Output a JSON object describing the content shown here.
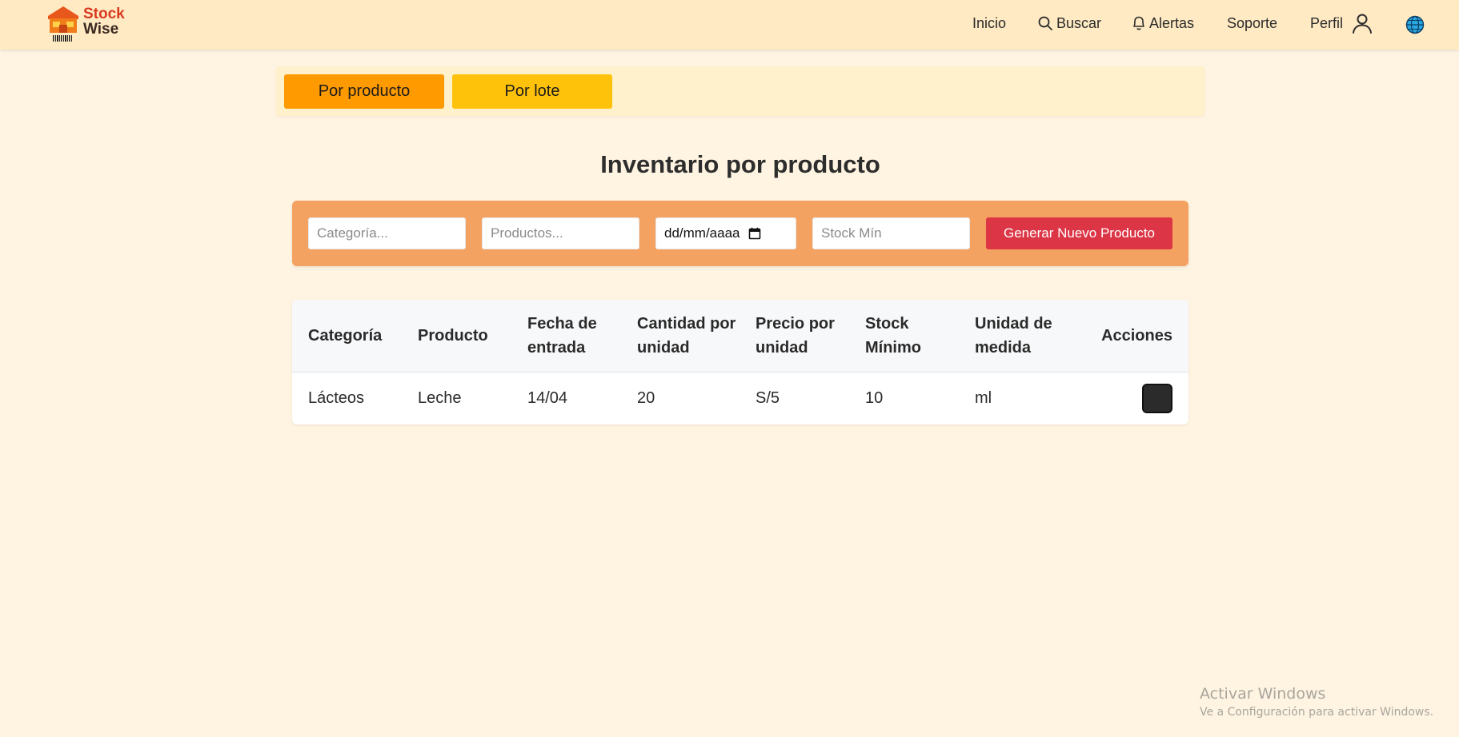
{
  "brand": {
    "line1": "Stock",
    "line2": "Wise"
  },
  "nav": {
    "inicio": "Inicio",
    "buscar": "Buscar",
    "alertas": "Alertas",
    "soporte": "Soporte",
    "perfil": "Perfil"
  },
  "tabs": {
    "por_producto": "Por producto",
    "por_lote": "Por lote"
  },
  "page_title": "Inventario por producto",
  "filters": {
    "categoria_placeholder": "Categoría...",
    "productos_placeholder": "Productos...",
    "date_placeholder": "dd/mm/aaaa",
    "stock_placeholder": "Stock Mín",
    "generate_label": "Generar Nuevo Producto"
  },
  "table": {
    "headers": {
      "categoria": "Categoría",
      "producto": "Producto",
      "fecha": "Fecha de entrada",
      "cantidad": "Cantidad por unidad",
      "precio": "Precio por unidad",
      "stock": "Stock Mínimo",
      "unidad": "Unidad de medida",
      "acciones": "Acciones"
    },
    "rows": [
      {
        "categoria": "Lácteos",
        "producto": "Leche",
        "fecha": "14/04",
        "cantidad": "20",
        "precio": "S/5",
        "stock": "10",
        "unidad": "ml"
      }
    ]
  },
  "watermark": {
    "line1": "Activar Windows",
    "line2": "Ve a Configuración para activar Windows."
  },
  "colors": {
    "navbar": "#ffeac3",
    "page_bg": "#fff4e1",
    "tab_active": "#ff9a00",
    "tab_inactive": "#ffc20a",
    "filters_bg": "#f4a261",
    "generate_button": "#dc3545"
  },
  "icons": {
    "logo": "warehouse-logo-icon",
    "buscar": "search-icon",
    "alertas": "bell-icon",
    "perfil": "user-icon",
    "language": "globe-icon",
    "date": "calendar-icon"
  }
}
